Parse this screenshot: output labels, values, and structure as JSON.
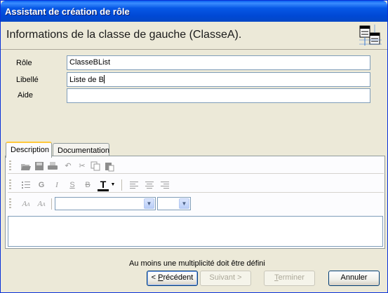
{
  "window": {
    "title": "Assistant de création de rôle"
  },
  "header": {
    "text": "Informations de la classe de gauche (ClasseA)."
  },
  "form": {
    "role_label": "Rôle",
    "role_value": "ClasseBList",
    "libelle_label": "Libellé",
    "libelle_value": "Liste de B",
    "aide_label": "Aide",
    "aide_value": ""
  },
  "tabs": [
    {
      "label": "Description"
    },
    {
      "label": "Documentation"
    }
  ],
  "toolbar": {
    "bold": "G",
    "italic": "I",
    "strike_s": "S",
    "strike_b": "B",
    "text_color": "T",
    "font_family": "",
    "font_size": ""
  },
  "status": "Au moins une multiplicité doit être défini",
  "buttons": {
    "prev_underlined": "P",
    "prev_rest": "récédent",
    "prev_prefix": "< ",
    "next": "Suivant >",
    "finish_underlined": "T",
    "finish_rest": "erminer",
    "cancel": "Annuler"
  }
}
